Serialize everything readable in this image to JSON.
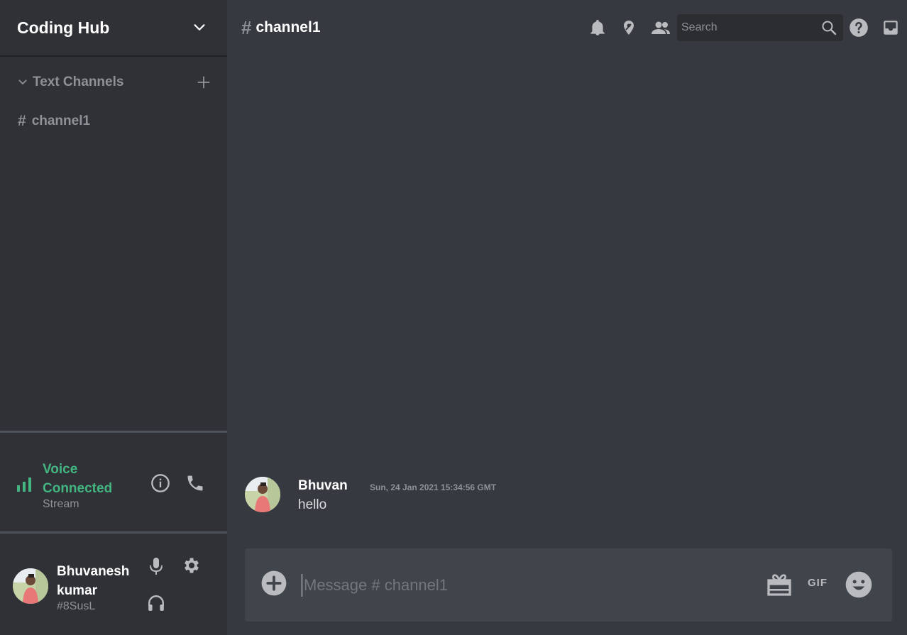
{
  "server": {
    "name": "Coding Hub"
  },
  "category": {
    "label": "Text Channels"
  },
  "channels": [
    {
      "hash": "#",
      "name": "channel1"
    }
  ],
  "voice": {
    "status": "Voice Connected",
    "sub": "Stream"
  },
  "user": {
    "name": "Bhuvanesh kumar",
    "tag": "#8SusL"
  },
  "topbar": {
    "hash": "#",
    "title": "channel1",
    "search_placeholder": "Search",
    "icons": [
      "bell-icon",
      "pin-icon",
      "members-icon",
      "search-icon",
      "help-icon",
      "inbox-icon"
    ]
  },
  "messages": [
    {
      "author": "Bhuvan",
      "timestamp": "Sun, 24 Jan 2021 15:34:56 GMT",
      "text": "hello"
    }
  ],
  "composer": {
    "placeholder": "Message # channel1",
    "gif_label": "GIF"
  },
  "colors": {
    "background": "#36393f",
    "sidebar": "#2f3136",
    "voice_green": "#43b581",
    "muted_text": "#8e9297",
    "input_bg": "#40444b"
  }
}
